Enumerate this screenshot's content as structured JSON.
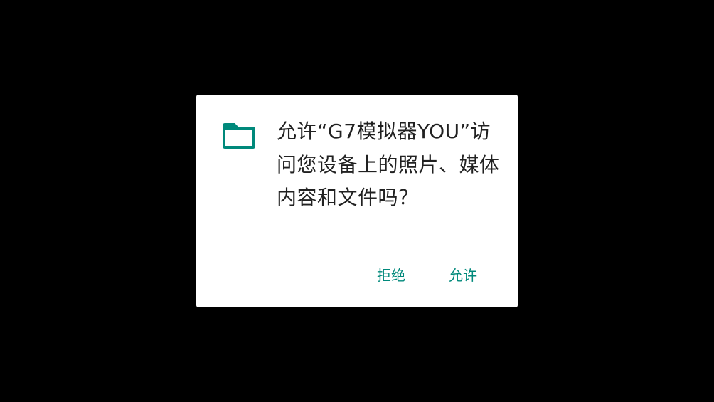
{
  "dialog": {
    "icon": "folder-icon",
    "message": "允许“G7模拟器YOU”访问您设备上的照片、媒体内容和文件吗？",
    "deny_label": "拒绝",
    "allow_label": "允许",
    "accent_color": "#00897b"
  }
}
